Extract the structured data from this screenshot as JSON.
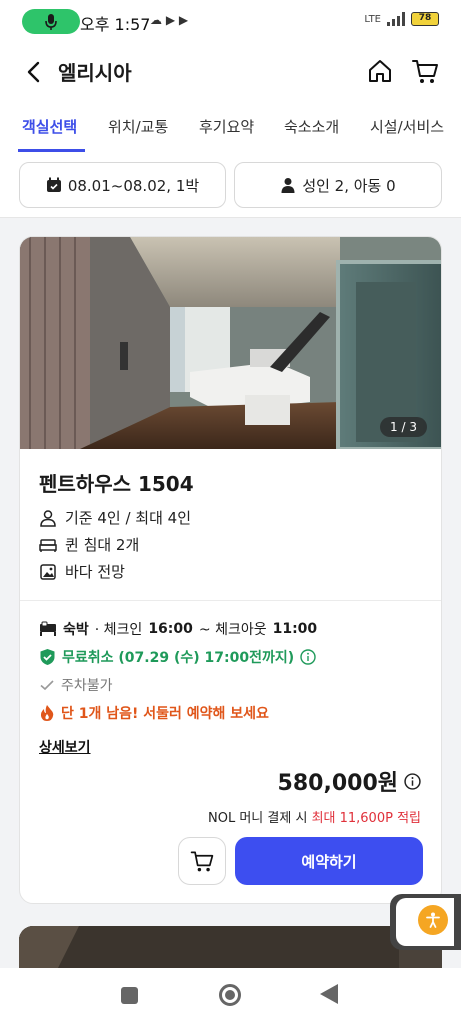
{
  "status_bar": {
    "time": "오후 1:57",
    "notif_icons": "☁ ▶ ▶",
    "network": "LTE",
    "battery": "78"
  },
  "header": {
    "title": "엘리시아"
  },
  "tabs": [
    {
      "label": "객실선택",
      "active": true
    },
    {
      "label": "위치/교통",
      "active": false
    },
    {
      "label": "후기요약",
      "active": false
    },
    {
      "label": "숙소소개",
      "active": false
    },
    {
      "label": "시설/서비스",
      "active": false
    }
  ],
  "filters": {
    "dates": "08.01~08.02, 1박",
    "guests": "성인 2, 아동 0"
  },
  "room": {
    "photo_counter": "1 / 3",
    "name": "펜트하우스 1504",
    "capacity": "기준 4인 / 최대 4인",
    "bed": "퀸 침대 2개",
    "view": "바다 전망",
    "stay_type": "숙박",
    "checkin_label": "· 체크인",
    "checkin_time": "16:00",
    "checkout_label": "~ 체크아웃",
    "checkout_time": "11:00",
    "cancel_policy": "무료취소 (07.29 (수) 17:00전까지)",
    "parking": "주차불가",
    "urgency": "단 1개 남음! 서둘러 예약해 보세요",
    "detail_link": "상세보기",
    "price": "580,000원",
    "points_prefix": "NOL 머니 결제 시",
    "points_value": "최대 11,600P 적립",
    "reserve_label": "예약하기"
  },
  "colors": {
    "accent": "#3d4ef0",
    "green": "#1f9a5a",
    "orange": "#e0561a",
    "red": "#e0303a"
  }
}
